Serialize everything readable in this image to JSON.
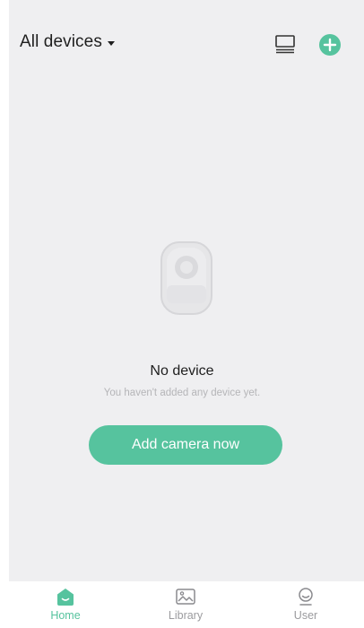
{
  "header": {
    "title": "All devices",
    "icons": [
      "device-list-icon",
      "add-circle-icon"
    ]
  },
  "empty_state": {
    "illustration": "camera-icon",
    "title": "No device",
    "subtitle": "You haven't added any device yet.",
    "cta_label": "Add camera now"
  },
  "tabbar": {
    "items": [
      {
        "label": "Home",
        "icon": "home-icon",
        "active": true
      },
      {
        "label": "Library",
        "icon": "image-icon",
        "active": false
      },
      {
        "label": "User",
        "icon": "user-icon",
        "active": false
      }
    ]
  },
  "colors": {
    "accent": "#56c39e",
    "background": "#efeff1",
    "inactive": "#9b9b9e"
  }
}
